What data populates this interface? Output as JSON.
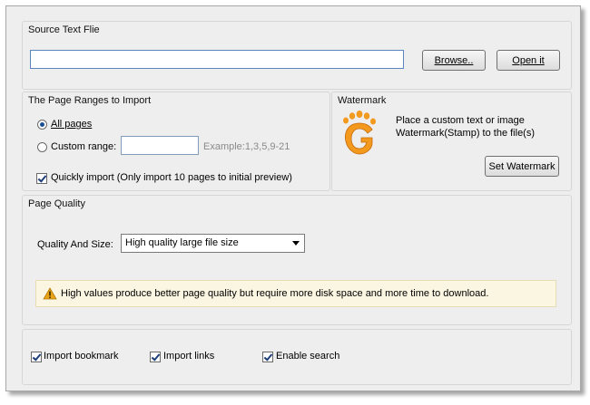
{
  "source": {
    "title": "Source Text Flie",
    "path_value": "",
    "browse_label": "Browse..",
    "open_label": "Open it"
  },
  "ranges": {
    "title": "The Page Ranges to Import",
    "all_pages_label": "All pages",
    "all_pages_selected": true,
    "custom_label": "Custom range:",
    "custom_value": "",
    "example_text": "Example:1,3,5,9-21",
    "quick_import_label": "Quickly import (Only import 10 pages to  initial  preview)",
    "quick_import_checked": true
  },
  "watermark": {
    "title": "Watermark",
    "icon": "footprint-logo-icon",
    "description": "Place a custom text or image Watermark(Stamp) to the file(s)",
    "button_label": "Set Watermark"
  },
  "quality": {
    "title": "Page Quality",
    "size_label": "Quality And Size:",
    "selected_option": "High quality large file size",
    "notice_text": "High values produce better page quality but require more disk space and more time to download.",
    "notice_icon": "warning-icon"
  },
  "options": {
    "import_bookmark_label": "Import bookmark",
    "import_links_label": "Import links",
    "enable_search_label": "Enable search",
    "import_bookmark_checked": true,
    "import_links_checked": true,
    "enable_search_checked": true
  },
  "colors": {
    "accent": "#1a4f9a",
    "notice_bg": "#fbf6e2",
    "warning": "#e8a317",
    "logo_orange": "#f39a1e"
  }
}
